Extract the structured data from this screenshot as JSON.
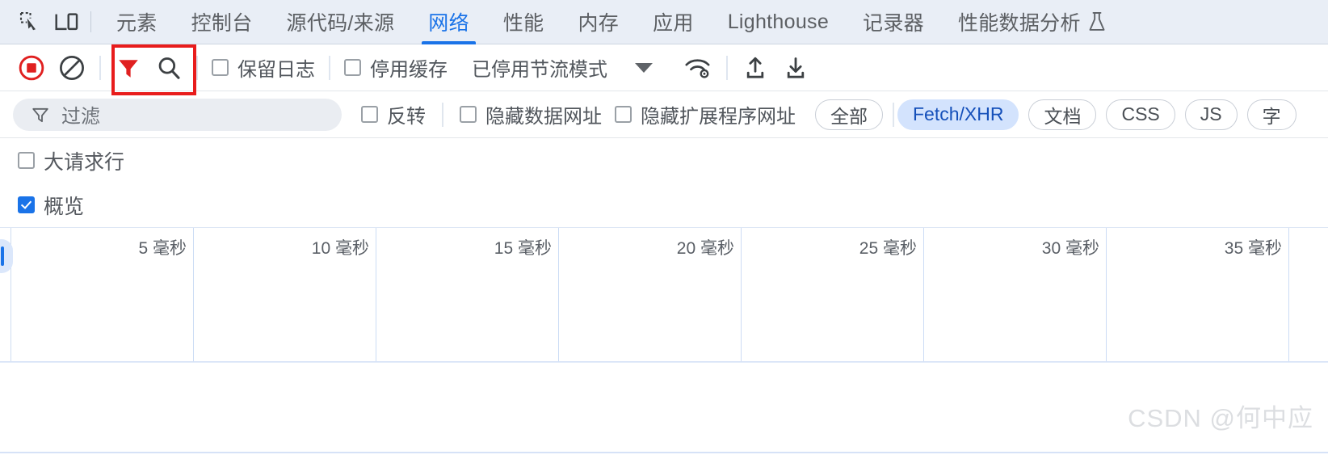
{
  "tabbar": {
    "inspect_icon": "inspect-element-icon",
    "device_icon": "device-toolbar-icon",
    "tabs": [
      {
        "label": "元素",
        "name": "tab-elements",
        "active": false
      },
      {
        "label": "控制台",
        "name": "tab-console",
        "active": false
      },
      {
        "label": "源代码/来源",
        "name": "tab-sources",
        "active": false
      },
      {
        "label": "网络",
        "name": "tab-network",
        "active": true
      },
      {
        "label": "性能",
        "name": "tab-performance",
        "active": false
      },
      {
        "label": "内存",
        "name": "tab-memory",
        "active": false
      },
      {
        "label": "应用",
        "name": "tab-application",
        "active": false
      },
      {
        "label": "Lighthouse",
        "name": "tab-lighthouse",
        "active": false
      },
      {
        "label": "记录器",
        "name": "tab-recorder",
        "active": false
      },
      {
        "label": "性能数据分析",
        "name": "tab-performance-insights",
        "active": false,
        "flask": true
      }
    ]
  },
  "toolbar": {
    "record_icon": "record-stop-icon",
    "clear_icon": "clear-network-log-icon",
    "filter_icon": "filter-funnel-icon",
    "search_icon": "search-magnifier-icon",
    "preserve_log_label": "保留日志",
    "preserve_log_checked": false,
    "disable_cache_label": "停用缓存",
    "disable_cache_checked": false,
    "throttling_label": "已停用节流模式",
    "network_conditions_icon": "network-conditions-wifi-gear-icon",
    "import_har_icon": "import-har-upload-icon",
    "export_har_icon": "export-har-download-icon"
  },
  "annotation": {
    "color": "#e81c1c",
    "target": "filter-funnel-icon"
  },
  "filterbar": {
    "filter_placeholder": "过滤",
    "filter_value": "",
    "filter_icon": "filter-funnel-icon",
    "invert_label": "反转",
    "invert_checked": false,
    "hide_data_urls_label": "隐藏数据网址",
    "hide_data_urls_checked": false,
    "hide_extension_urls_label": "隐藏扩展程序网址",
    "hide_extension_urls_checked": false,
    "type_chips": [
      {
        "label": "全部",
        "name": "filter-chip-all",
        "selected": false
      },
      {
        "label": "Fetch/XHR",
        "name": "filter-chip-fetch-xhr",
        "selected": true
      },
      {
        "label": "文档",
        "name": "filter-chip-doc",
        "selected": false
      },
      {
        "label": "CSS",
        "name": "filter-chip-css",
        "selected": false
      },
      {
        "label": "JS",
        "name": "filter-chip-js",
        "selected": false
      },
      {
        "label": "字",
        "name": "filter-chip-font",
        "selected": false
      }
    ]
  },
  "options": {
    "big_request_rows_label": "大请求行",
    "big_request_rows_checked": false,
    "overview_label": "概览",
    "overview_checked": true
  },
  "chart_data": {
    "type": "timeline",
    "title": "概览",
    "xlabel": "",
    "unit": "毫秒",
    "tick_labels": [
      "5 毫秒",
      "10 毫秒",
      "15 毫秒",
      "20 毫秒",
      "25 毫秒",
      "30 毫秒",
      "35 毫秒"
    ],
    "tick_values": [
      5,
      10,
      15,
      20,
      25,
      30,
      35
    ],
    "series": [],
    "grid": true
  },
  "watermark": "CSDN @何中应"
}
